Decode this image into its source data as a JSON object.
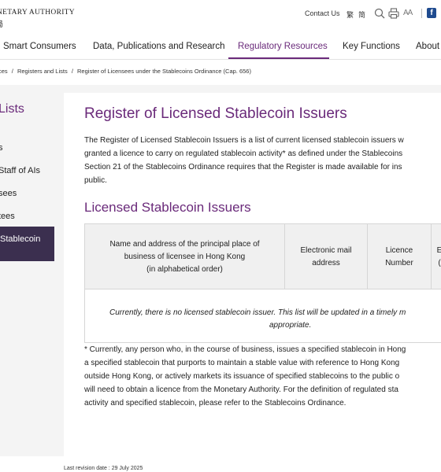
{
  "header": {
    "logo_line1": "NETARY AUTHORITY",
    "logo_line2": "局",
    "contact_label": "Contact Us",
    "lang_traditional": "繁",
    "lang_simplified": "简",
    "font_size_label": "AA"
  },
  "nav": {
    "items": [
      "Smart Consumers",
      "Data, Publications and Research",
      "Regulatory Resources",
      "Key Functions",
      "About"
    ],
    "active": "Regulatory Resources"
  },
  "breadcrumb": {
    "part1": "ces",
    "part2": "Registers and Lists",
    "part3": "Register of Licensees under the Stablecoins Ordinance (Cap. 656)",
    "separator": "/"
  },
  "sidebar": {
    "title": "Lists",
    "items": [
      "s",
      "Staff of AIs",
      "sees",
      "tees",
      "Stablecoin"
    ]
  },
  "main": {
    "title": "Register of Licensed Stablecoin Issuers",
    "intro_lines": [
      "The Register of Licensed Stablecoin Issuers is a list of current licensed stablecoin issuers w",
      "granted a licence to carry on regulated stablecoin activity* as defined under the Stablecoins",
      "Section 21 of the Stablecoins Ordinance requires that the Register is made available for ins",
      "public."
    ],
    "subtitle": "Licensed Stablecoin Issuers",
    "table": {
      "columns": [
        {
          "lines": [
            "Name and address of the principal place of",
            "business of licensee in Hong Kong",
            "(in alphabetical order)"
          ]
        },
        {
          "lines": [
            "Electronic mail",
            "address"
          ]
        },
        {
          "lines": [
            "Licence",
            "Number"
          ]
        },
        {
          "lines": [
            "E",
            "("
          ]
        }
      ],
      "empty_line1": "Currently, there is no licensed stablecoin issuer. This list will be updated in a timely m",
      "empty_line2": "appropriate."
    },
    "footnote_lines": [
      "* Currently, any person who, in the course of business, issues a specified stablecoin in Hong",
      "a specified stablecoin that purports to maintain a stable value with reference to Hong Kong",
      "outside Hong Kong, or actively markets its issuance of specified stablecoins to the public o",
      "will need to obtain a licence from the Monetary Authority.  For the definition of regulated sta",
      "activity and specified stablecoin, please refer to the Stablecoins Ordinance."
    ],
    "revision": "Last revision date : 29 July 2025"
  },
  "colors": {
    "accent": "#6a2a7a",
    "sidebar_active_bg": "#3b2f4f",
    "facebook": "#1f4b8f"
  }
}
